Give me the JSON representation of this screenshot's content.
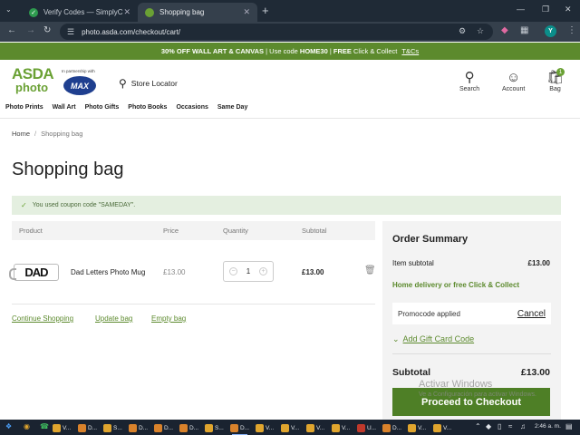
{
  "browser": {
    "tabs": [
      {
        "title": "Verify Codes — SimplyCodes",
        "active": false,
        "favicon_color": "#2e9b4f"
      },
      {
        "title": "Shopping bag",
        "active": true,
        "favicon_color": "#6aa134"
      }
    ],
    "url": "photo.asda.com/checkout/cart/",
    "profile_initial": "Y"
  },
  "promo_banner": {
    "part1": "30% OFF WALL ART & CANVAS",
    "part2": " | Use code ",
    "code": "HOME30",
    "part3": " | ",
    "free": "FREE",
    "part4": " Click & Collect ",
    "tc": "T&Cs"
  },
  "header": {
    "logo_line1": "ASDA",
    "logo_line2": "photo",
    "partner_text": "In partnership with",
    "partner_logo": "MAX",
    "store_locator": "Store Locator",
    "search": "Search",
    "account": "Account",
    "bag": "Bag",
    "bag_count": "1",
    "nav": [
      "Photo Prints",
      "Wall Art",
      "Photo Gifts",
      "Photo Books",
      "Occasions",
      "Same Day"
    ]
  },
  "breadcrumb": {
    "home": "Home",
    "separator": "/",
    "current": "Shopping bag"
  },
  "page_title": "Shopping bag",
  "notice": "You used coupon code \"SAMEDAY\".",
  "cart": {
    "columns": [
      "Product",
      "Price",
      "Quantity",
      "Subtotal"
    ],
    "items": [
      {
        "thumb_text": "DAD",
        "name": "Dad Letters Photo Mug",
        "price": "£13.00",
        "quantity": "1",
        "subtotal": "£13.00"
      }
    ],
    "continue_shopping": "Continue Shopping",
    "update_bag": "Update bag",
    "empty_bag": "Empty bag"
  },
  "summary": {
    "title": "Order Summary",
    "item_subtotal_label": "Item subtotal",
    "item_subtotal_value": "£13.00",
    "delivery_text": "Home delivery or free Click & Collect",
    "promocode_label": "Promocode applied",
    "cancel_label": "Cancel",
    "gift_card_label": "Add Gift Card Code",
    "subtotal_label": "Subtotal",
    "subtotal_value": "£13.00",
    "checkout_label": "Proceed to Checkout"
  },
  "watermark": {
    "line1": "Activar Windows",
    "line2": "Ve a Configuración para activar Windows."
  },
  "taskbar": {
    "items": [
      {
        "label": "V...",
        "color": "#e0a52e"
      },
      {
        "label": "D...",
        "color": "#d9822b"
      },
      {
        "label": "S...",
        "color": "#e0a52e"
      },
      {
        "label": "D...",
        "color": "#d9822b"
      },
      {
        "label": "D...",
        "color": "#d9822b"
      },
      {
        "label": "D...",
        "color": "#d9822b"
      },
      {
        "label": "S...",
        "color": "#e0a52e"
      },
      {
        "label": "D...",
        "color": "#d9822b"
      },
      {
        "label": "V...",
        "color": "#e0a52e"
      },
      {
        "label": "V...",
        "color": "#e0a52e"
      },
      {
        "label": "V...",
        "color": "#e0a52e"
      },
      {
        "label": "V...",
        "color": "#e0a52e"
      },
      {
        "label": "U...",
        "color": "#c0392b"
      },
      {
        "label": "D...",
        "color": "#d9822b"
      },
      {
        "label": "V...",
        "color": "#e0a52e"
      },
      {
        "label": "V...",
        "color": "#e0a52e"
      }
    ],
    "clock": "2:46 a. m."
  },
  "colors": {
    "brand_green": "#6aa134",
    "banner_green": "#5c8a2d",
    "checkout_green": "#4e7f26"
  }
}
